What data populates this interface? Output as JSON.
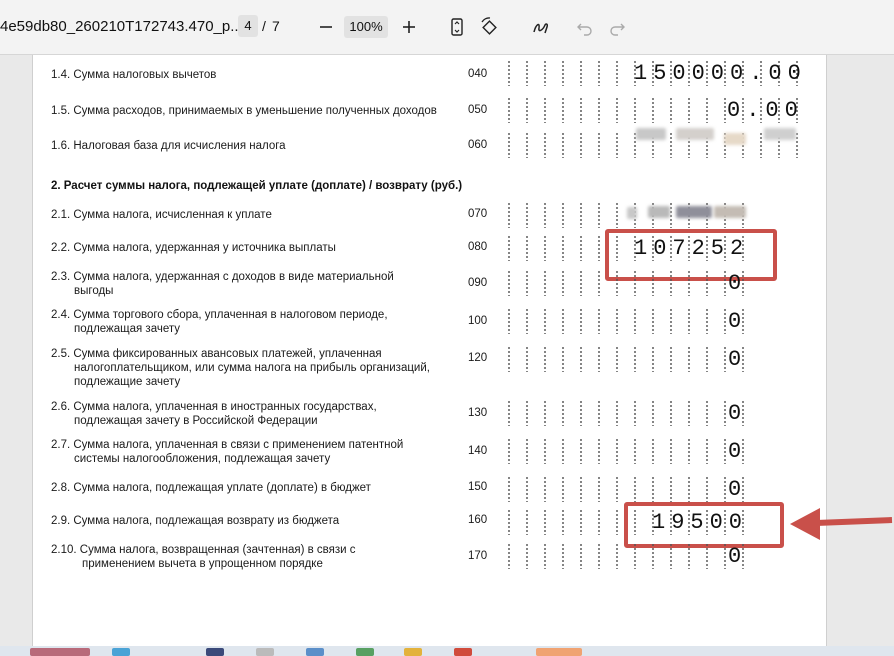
{
  "toolbar": {
    "filename": "4e59db80_260210T172743.470_p...",
    "current_page": "4",
    "separator": "/",
    "total_pages": "7",
    "zoom": "100%"
  },
  "rows": [
    {
      "label": "1.4. Сумма налоговых вычетов",
      "code": "040",
      "value": "150000.00"
    },
    {
      "label": "1.5. Сумма расходов, принимаемых в уменьшение полученных доходов",
      "code": "050",
      "value": "0.00"
    },
    {
      "label": "1.6. Налоговая база для исчисления налога",
      "code": "060",
      "value": ""
    },
    {
      "label": "2.1. Сумма налога, исчисленная к уплате",
      "code": "070",
      "value": ""
    },
    {
      "label": "2.2. Сумма налога, удержанная у источника выплаты",
      "code": "080",
      "value": "107252"
    },
    {
      "label_line1": "2.3. Сумма налога, удержанная с доходов в виде материальной",
      "label_line2": "выгоды",
      "code": "090",
      "value": "0"
    },
    {
      "label_line1": "2.4. Сумма торгового сбора, уплаченная в налоговом периоде,",
      "label_line2": "подлежащая зачету",
      "code": "100",
      "value": "0"
    },
    {
      "label_line1": "2.5. Сумма фиксированных авансовых платежей, уплаченная",
      "label_line2": "налогоплательщиком, или сумма налога на прибыль организаций,",
      "label_line3": "подлежащие зачету",
      "code": "120",
      "value": "0"
    },
    {
      "label_line1": "2.6. Сумма налога, уплаченная в иностранных государствах,",
      "label_line2": "подлежащая зачету в Российской Федерации",
      "code": "130",
      "value": "0"
    },
    {
      "label_line1": "2.7. Сумма налога, уплаченная в связи с применением патентной",
      "label_line2": "системы налогообложения, подлежащая зачету",
      "code": "140",
      "value": "0"
    },
    {
      "label": "2.8. Сумма налога, подлежащая уплате (доплате) в бюджет",
      "code": "150",
      "value": "0"
    },
    {
      "label": "2.9. Сумма налога, подлежащая возврату из бюджета",
      "code": "160",
      "value": "19500"
    },
    {
      "label_line1": "2.10. Сумма налога, возвращенная (зачтенная) в связи с",
      "label_line2": "применением вычета в упрощенном порядке",
      "code": "170",
      "value": "0"
    }
  ],
  "section2_title": "2. Расчет суммы налога, подлежащей уплате (доплате) / возврату (руб.)",
  "colors": {
    "highlight": "#c9504a",
    "toolbar_bg": "#f3f3f3"
  }
}
